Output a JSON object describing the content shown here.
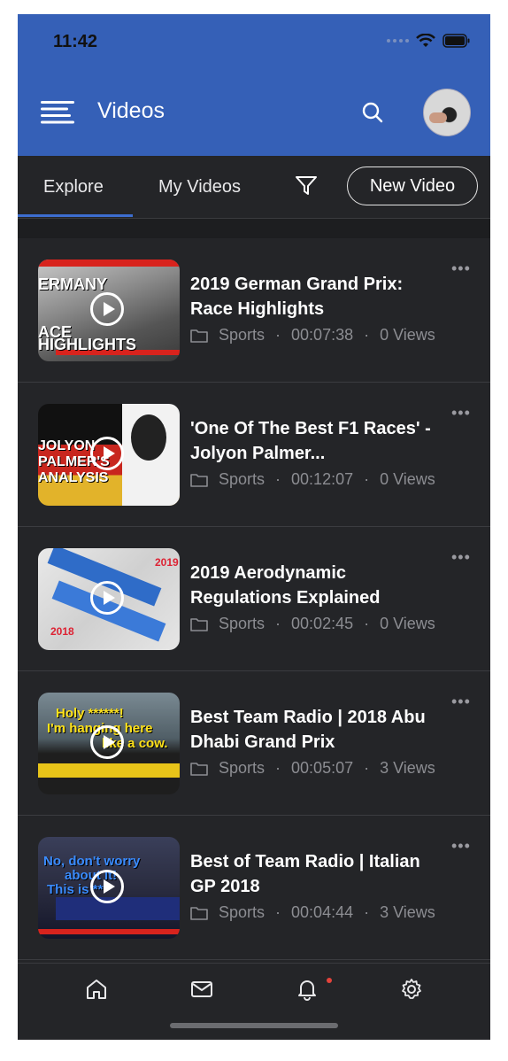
{
  "status": {
    "time": "11:42"
  },
  "header": {
    "title": "Videos",
    "menu_icon": "hamburger-menu-icon",
    "search_icon": "search-icon",
    "avatar": "user-avatar"
  },
  "tabs": {
    "explore": "Explore",
    "my_videos": "My Videos",
    "new_video": "New Video",
    "filter_icon": "filter-icon"
  },
  "videos": [
    {
      "title": "2019 German Grand Prix: Race Highlights",
      "category": "Sports",
      "duration": "00:07:38",
      "views": "0 Views",
      "thumb_text": [
        "ERMANY",
        "ACE",
        "HIGHLIGHTS"
      ]
    },
    {
      "title": "'One Of The Best F1 Races' - Jolyon Palmer...",
      "category": "Sports",
      "duration": "00:12:07",
      "views": "0 Views",
      "thumb_text": [
        "JOLYON",
        "PALMER'S",
        "ANALYSIS"
      ]
    },
    {
      "title": "2019 Aerodynamic Regulations Explained",
      "category": "Sports",
      "duration": "00:02:45",
      "views": "0 Views",
      "thumb_text": [
        "2019",
        "2018"
      ]
    },
    {
      "title": "Best Team Radio | 2018 Abu Dhabi Grand Prix",
      "category": "Sports",
      "duration": "00:05:07",
      "views": "3 Views",
      "thumb_text": [
        "Holy ******!",
        "I'm hanging here",
        "like a cow."
      ]
    },
    {
      "title": "Best of Team Radio | Italian GP 2018",
      "category": "Sports",
      "duration": "00:04:44",
      "views": "3 Views",
      "thumb_text": [
        "No, don't worry",
        "about it!",
        "This is ***"
      ]
    }
  ],
  "bottom_nav": [
    "home-icon",
    "mail-icon",
    "bell-icon",
    "gear-icon"
  ],
  "colors": {
    "header": "#3560b7",
    "background": "#242528",
    "accent": "#3d6ed0",
    "badge": "#e4433b"
  }
}
